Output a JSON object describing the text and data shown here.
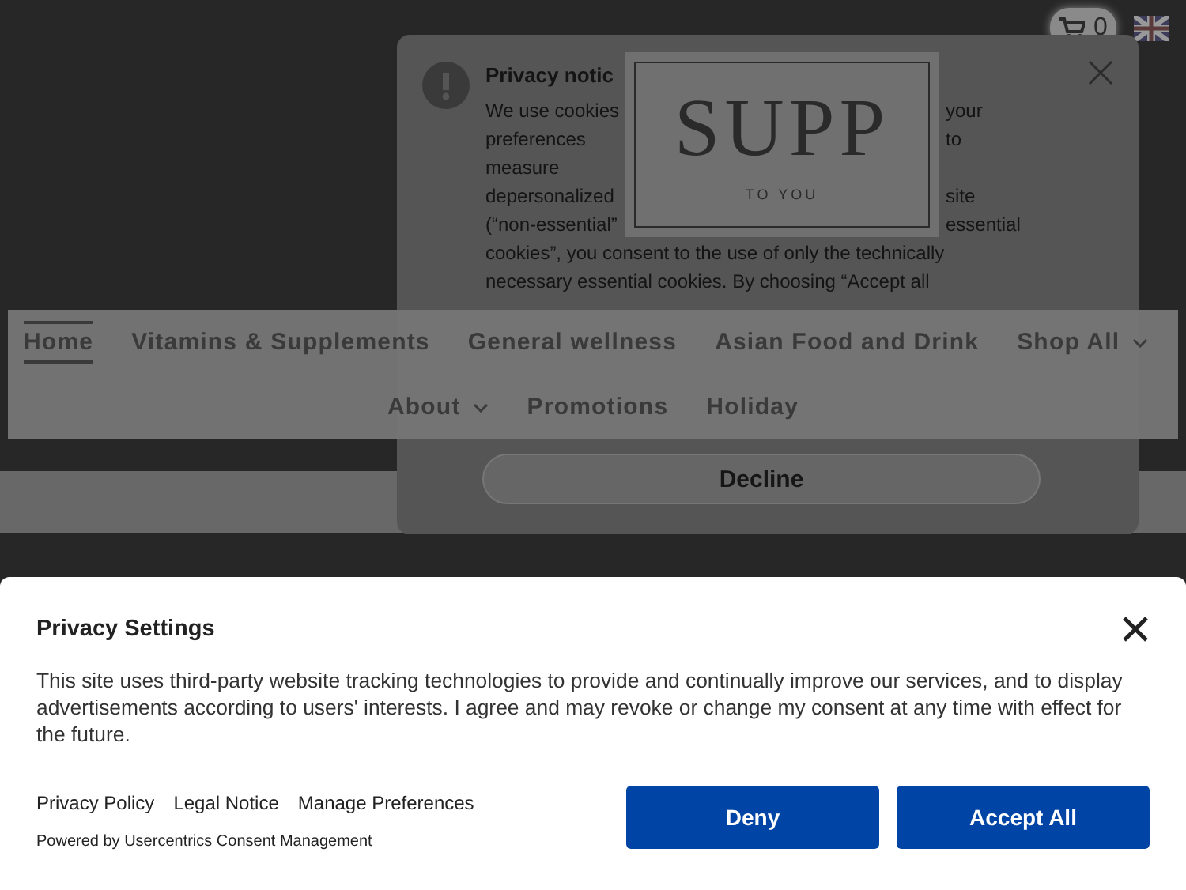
{
  "cart": {
    "count": "0"
  },
  "notice": {
    "title": "Privacy notic",
    "covered_lines": [
      {
        "left": "We use cookies",
        "right": "your"
      },
      {
        "left": "preferences",
        "right": "to"
      },
      {
        "left": "measure"
      },
      {
        "left": "depersonalized",
        "right": "site"
      },
      {
        "left": "(“non-essential”",
        "right": "essential"
      }
    ],
    "lines": [
      "cookies”, you consent to the use of only the technically",
      "necessary essential cookies. By choosing “Accept all"
    ],
    "buttons": [
      "Decline"
    ]
  },
  "logo": {
    "main": "SUPP",
    "sub": "TO YOU"
  },
  "nav": {
    "primary": [
      {
        "label": "Home",
        "selected": true,
        "dropdown": false
      },
      {
        "label": "Vitamins & Supplements",
        "selected": false,
        "dropdown": false
      },
      {
        "label": "General wellness",
        "selected": false,
        "dropdown": false
      },
      {
        "label": "Asian Food and Drink",
        "selected": false,
        "dropdown": false
      },
      {
        "label": "Shop All",
        "selected": false,
        "dropdown": true
      }
    ],
    "secondary": [
      {
        "label": "About",
        "selected": false,
        "dropdown": true
      },
      {
        "label": "Promotions",
        "selected": false,
        "dropdown": false
      },
      {
        "label": "Holiday",
        "selected": false,
        "dropdown": false
      }
    ]
  },
  "banner": {
    "title": "Privacy Settings",
    "text": "This site uses third-party website tracking technologies to provide and continually improve our services, and to display advertisements according to users' interests. I agree and may revoke or change my consent at any time with effect for the future.",
    "links": [
      "Privacy Policy",
      "Legal Notice",
      "Manage Preferences"
    ],
    "powered": "Powered by Usercentrics Consent Management",
    "buttons": [
      "Deny",
      "Accept All"
    ]
  }
}
